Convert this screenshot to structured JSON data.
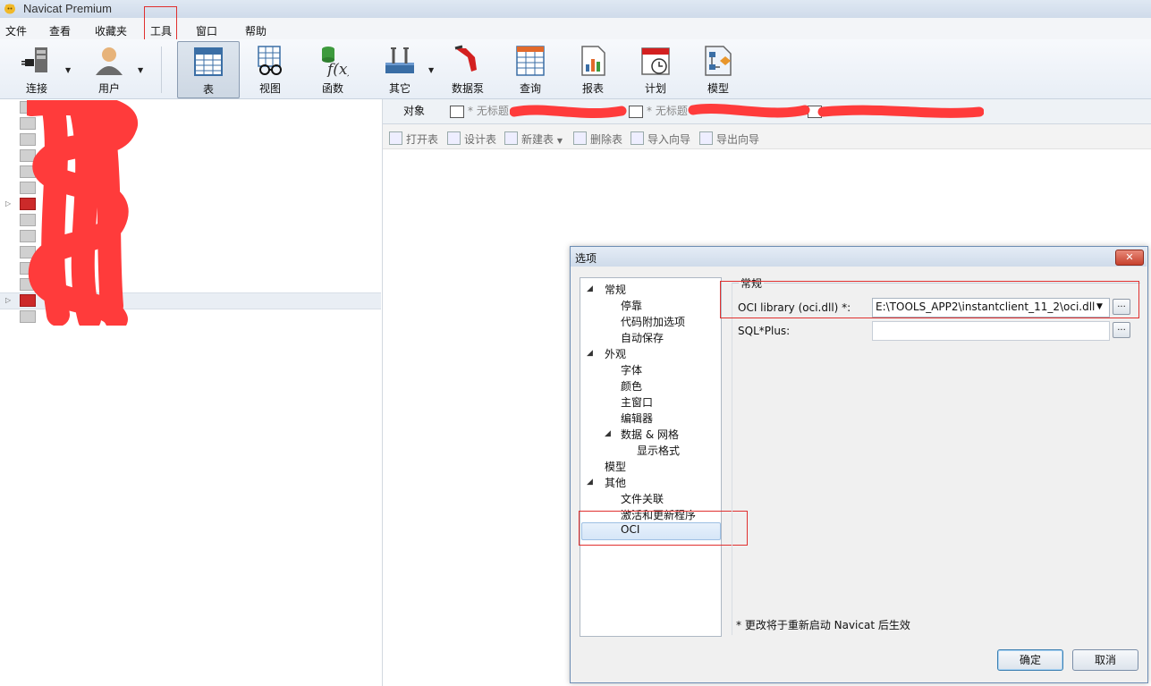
{
  "window": {
    "title": "Navicat Premium"
  },
  "menu": [
    "文件",
    "查看",
    "收藏夹",
    "工具",
    "窗口",
    "帮助"
  ],
  "toolbar": {
    "buttons": [
      "连接",
      "用户",
      "表",
      "视图",
      "函数",
      "其它",
      "数据泵",
      "查询",
      "报表",
      "计划",
      "模型"
    ]
  },
  "tabs": {
    "objects": "对象",
    "untitled_1": "* 无标题",
    "untitled_2": "* 无标题"
  },
  "object_toolbar": [
    "打开表",
    "设计表",
    "新建表",
    "删除表",
    "导入向导",
    "导出向导"
  ],
  "dialog": {
    "title": "选项",
    "close": "✕",
    "nav": {
      "general": "常规",
      "dock": "停靠",
      "code_options": "代码附加选项",
      "autosave": "自动保存",
      "appearance": "外观",
      "font": "字体",
      "color": "颜色",
      "main_window": "主窗口",
      "editor": "编辑器",
      "data_grid": "数据 & 网格",
      "display_format": "显示格式",
      "model": "模型",
      "other": "其他",
      "file_assoc": "文件关联",
      "activation": "激活和更新程序",
      "oci": "OCI"
    },
    "section_title": "常规",
    "oci_label": "OCI library (oci.dll) *:",
    "oci_value": "E:\\TOOLS_APP2\\instantclient_11_2\\oci.dll",
    "sqlplus_label": "SQL*Plus:",
    "sqlplus_value": "",
    "browse": "...",
    "note": "* 更改将于重新启动 Navicat 后生效",
    "ok": "确定",
    "cancel": "取消"
  }
}
